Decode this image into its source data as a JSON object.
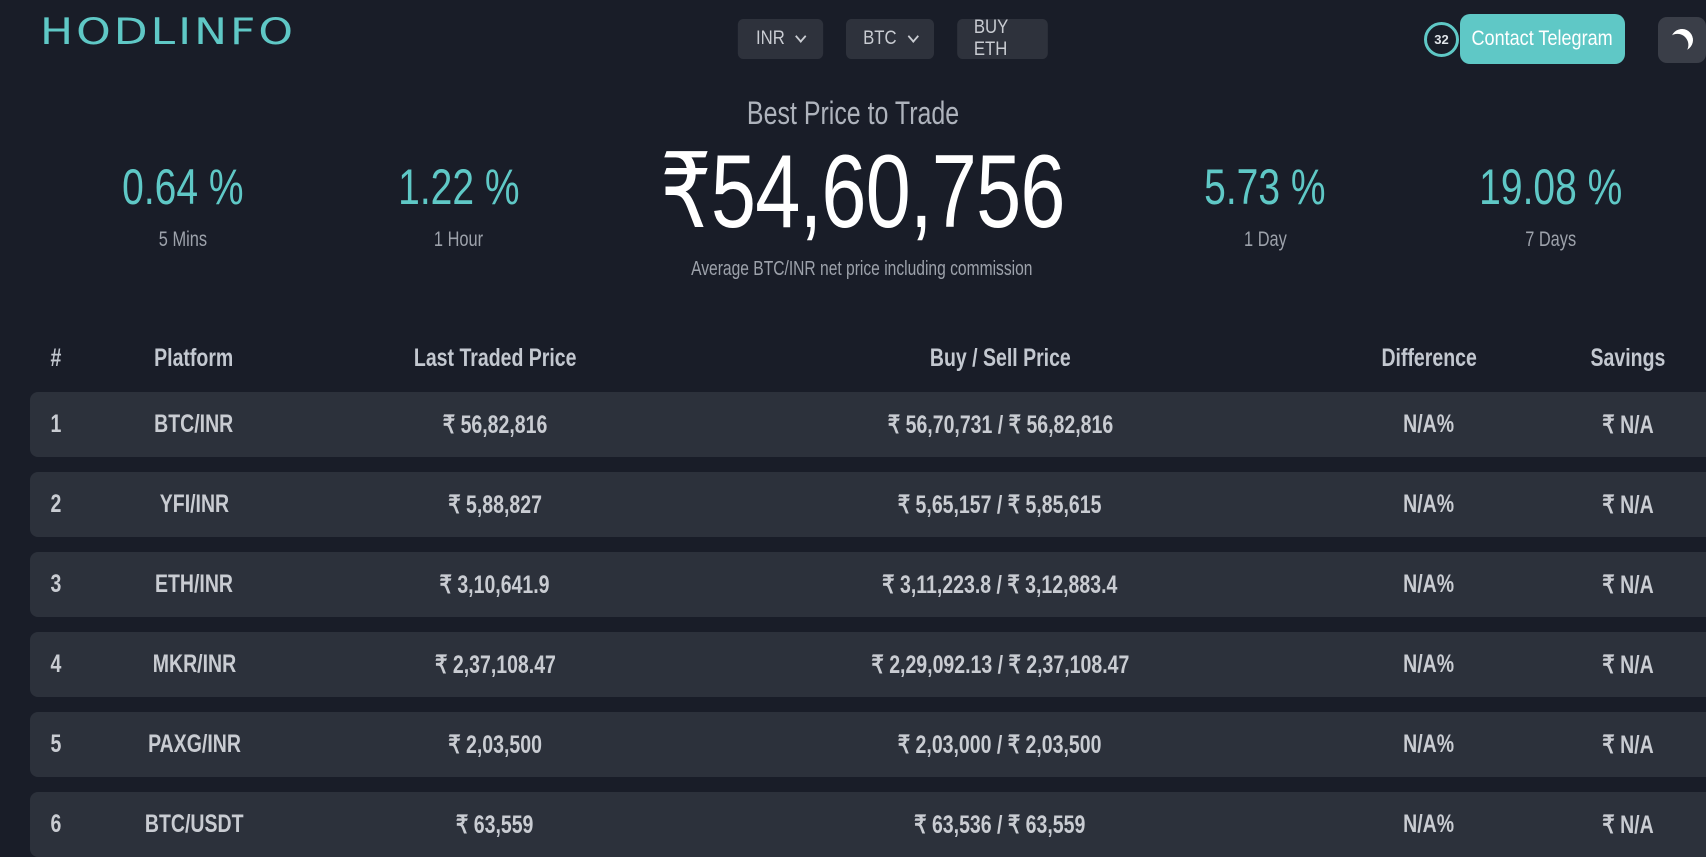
{
  "header": {
    "logo": "HODLINFO",
    "currency_select": "INR",
    "coin_select": "BTC",
    "buy_button": "BUY ETH",
    "timer": "32",
    "telegram_button": "Contact Telegram",
    "theme_icon": "moon-icon",
    "accent_color": "#5fc8c6"
  },
  "hero": {
    "subtitle": "Best Price to Trade",
    "price": "₹54,60,756",
    "note": "Average BTC/INR net price including commission",
    "stats": [
      {
        "pct": "0.64 %",
        "label": "5 Mins"
      },
      {
        "pct": "1.22 %",
        "label": "1 Hour"
      },
      {
        "pct": "5.73 %",
        "label": "1 Day"
      },
      {
        "pct": "19.08 %",
        "label": "7 Days"
      }
    ]
  },
  "table": {
    "headers": [
      "#",
      "Platform",
      "Last Traded Price",
      "Buy / Sell Price",
      "Difference",
      "Savings"
    ],
    "rows": [
      {
        "num": "1",
        "platform": "BTC/INR",
        "last": "₹ 56,82,816",
        "buysell": "₹ 56,70,731 / ₹ 56,82,816",
        "diff": "N/A%",
        "savings": "₹ N/A"
      },
      {
        "num": "2",
        "platform": "YFI/INR",
        "last": "₹ 5,88,827",
        "buysell": "₹ 5,65,157 / ₹ 5,85,615",
        "diff": "N/A%",
        "savings": "₹ N/A"
      },
      {
        "num": "3",
        "platform": "ETH/INR",
        "last": "₹ 3,10,641.9",
        "buysell": "₹ 3,11,223.8 / ₹ 3,12,883.4",
        "diff": "N/A%",
        "savings": "₹ N/A"
      },
      {
        "num": "4",
        "platform": "MKR/INR",
        "last": "₹ 2,37,108.47",
        "buysell": "₹ 2,29,092.13 / ₹ 2,37,108.47",
        "diff": "N/A%",
        "savings": "₹ N/A"
      },
      {
        "num": "5",
        "platform": "PAXG/INR",
        "last": "₹ 2,03,500",
        "buysell": "₹ 2,03,000 / ₹ 2,03,500",
        "diff": "N/A%",
        "savings": "₹ N/A"
      },
      {
        "num": "6",
        "platform": "BTC/USDT",
        "last": "₹ 63,559",
        "buysell": "₹ 63,536 / ₹ 63,559",
        "diff": "N/A%",
        "savings": "₹ N/A"
      }
    ]
  }
}
